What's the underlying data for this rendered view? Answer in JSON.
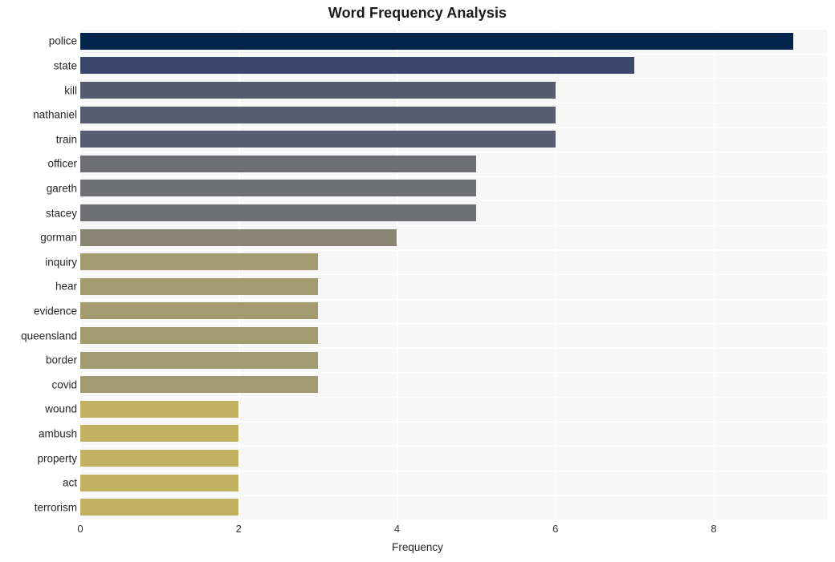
{
  "chart_data": {
    "type": "bar",
    "orientation": "horizontal",
    "title": "Word Frequency Analysis",
    "xlabel": "Frequency",
    "ylabel": "",
    "xlim": [
      0,
      9.43
    ],
    "xticks": [
      0,
      2,
      4,
      6,
      8
    ],
    "xtick_labels": [
      "0",
      "2",
      "4",
      "6",
      "8"
    ],
    "grid": true,
    "grid_color": "#ffffff",
    "plot_background": "#f7f7f7",
    "figure_background": "#ffffff",
    "legend": "none",
    "categories": [
      "police",
      "state",
      "kill",
      "nathaniel",
      "train",
      "officer",
      "gareth",
      "stacey",
      "gorman",
      "inquiry",
      "hear",
      "evidence",
      "queensland",
      "border",
      "covid",
      "wound",
      "ambush",
      "property",
      "act",
      "terrorism"
    ],
    "values": [
      9,
      7,
      6,
      6,
      6,
      5,
      5,
      5,
      4,
      3,
      3,
      3,
      3,
      3,
      3,
      2,
      2,
      2,
      2,
      2
    ],
    "bar_colors": [
      "#03244d",
      "#3b486e",
      "#575b70",
      "#585c71",
      "#585c72",
      "#6d6f72",
      "#6e7073",
      "#6e7073",
      "#888573",
      "#a39a6f",
      "#a39a6f",
      "#a39a6f",
      "#a39b70",
      "#a29a70",
      "#a29a70",
      "#c2b160",
      "#c2b160",
      "#c2b160",
      "#c2b160",
      "#c2b160"
    ]
  }
}
